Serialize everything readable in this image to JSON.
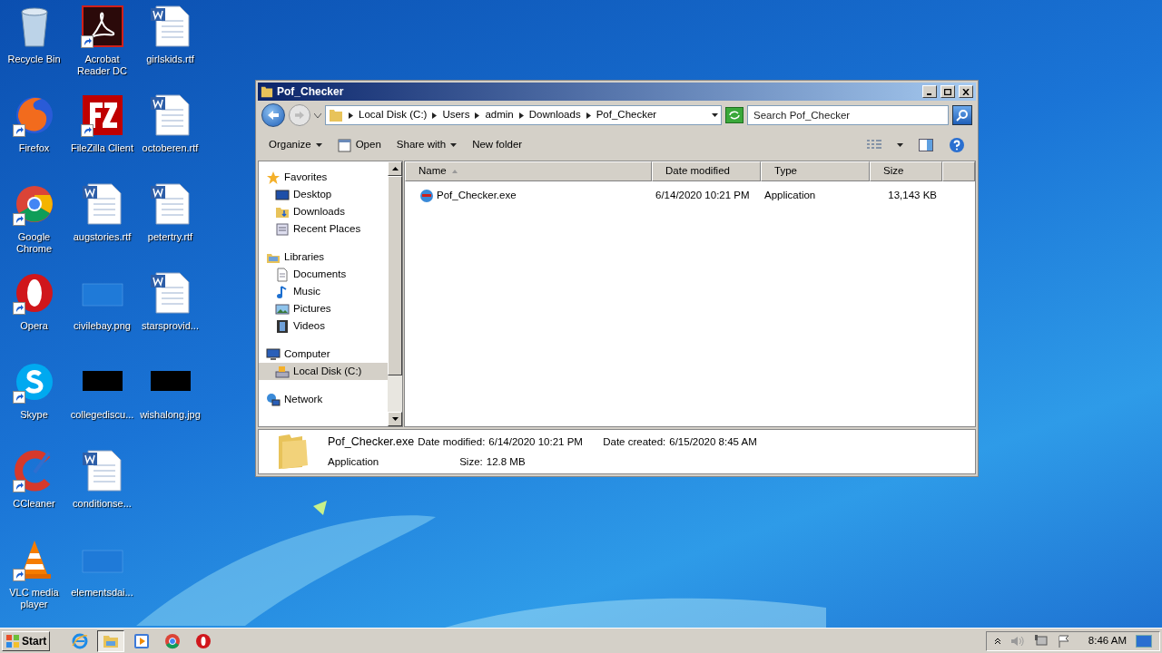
{
  "desktop_icons": [
    {
      "label": "Recycle Bin",
      "kind": "recycle",
      "shortcut": false
    },
    {
      "label": "Firefox",
      "kind": "fox",
      "shortcut": true
    },
    {
      "label": "Google Chrome",
      "kind": "chrome",
      "shortcut": true
    },
    {
      "label": "Opera",
      "kind": "opera",
      "shortcut": true
    },
    {
      "label": "Skype",
      "kind": "skype",
      "shortcut": true
    },
    {
      "label": "CCleaner",
      "kind": "cleaner",
      "shortcut": true
    },
    {
      "label": "VLC media player",
      "kind": "cone",
      "shortcut": true
    },
    {
      "label": "Acrobat Reader DC",
      "kind": "pdf",
      "shortcut": true
    },
    {
      "label": "FileZilla Client",
      "kind": "ftp",
      "shortcut": true
    },
    {
      "label": "augstories.rtf",
      "kind": "doc",
      "shortcut": false
    },
    {
      "label": "civilebay.png",
      "kind": "blank",
      "shortcut": false
    },
    {
      "label": "collegediscu...",
      "kind": "dark",
      "shortcut": false
    },
    {
      "label": "conditionse...",
      "kind": "doc",
      "shortcut": false
    },
    {
      "label": "elementsdai...",
      "kind": "blank",
      "shortcut": false
    },
    {
      "label": "girlskids.rtf",
      "kind": "doc",
      "shortcut": false
    },
    {
      "label": "octoberen.rtf",
      "kind": "doc",
      "shortcut": false
    },
    {
      "label": "petertry.rtf",
      "kind": "doc",
      "shortcut": false
    },
    {
      "label": "starsprovid...",
      "kind": "doc",
      "shortcut": false
    },
    {
      "label": "wishalong.jpg",
      "kind": "dark",
      "shortcut": false
    }
  ],
  "window": {
    "title": "Pof_Checker",
    "breadcrumb": [
      "Local Disk (C:)",
      "Users",
      "admin",
      "Downloads",
      "Pof_Checker"
    ],
    "search": {
      "placeholder": "Search Pof_Checker"
    },
    "toolbar": [
      {
        "label": "Organize",
        "kind": "menu"
      },
      {
        "label": "Open",
        "kind": "open"
      },
      {
        "label": "Share with",
        "kind": "menu"
      },
      {
        "label": "New folder",
        "kind": "plain"
      }
    ],
    "sidebar": [
      {
        "label": "Favorites",
        "kind": "star",
        "selected": false,
        "children": [
          {
            "label": "Desktop",
            "kind": "desktop",
            "selected": false
          },
          {
            "label": "Downloads",
            "kind": "downloads",
            "selected": false
          },
          {
            "label": "Recent Places",
            "kind": "recent",
            "selected": false
          }
        ]
      },
      {
        "label": "Libraries",
        "kind": "library",
        "selected": false,
        "children": [
          {
            "label": "Documents",
            "kind": "document",
            "selected": false
          },
          {
            "label": "Music",
            "kind": "music",
            "selected": false
          },
          {
            "label": "Pictures",
            "kind": "pictures",
            "selected": false
          },
          {
            "label": "Videos",
            "kind": "videos",
            "selected": false
          }
        ]
      },
      {
        "label": "Computer",
        "kind": "computer",
        "selected": false,
        "children": [
          {
            "label": "Local Disk (C:)",
            "kind": "disk",
            "selected": true
          }
        ]
      },
      {
        "label": "Network",
        "kind": "network",
        "selected": false
      }
    ],
    "columns": [
      {
        "label": "Name",
        "sorted": true
      },
      {
        "label": "Date modified",
        "sorted": false
      },
      {
        "label": "Type",
        "sorted": false
      },
      {
        "label": "Size",
        "sorted": false
      }
    ],
    "rows": [
      {
        "name": "Pof_Checker.exe",
        "date_modified": "6/14/2020 10:21 PM",
        "type": "Application",
        "size": "13,143 KB"
      }
    ],
    "details": {
      "name": "Pof_Checker.exe",
      "type": "Application",
      "date_modified_label": "Date modified:",
      "date_modified": "6/14/2020 10:21 PM",
      "date_created_label": "Date created:",
      "date_created": "6/15/2020 8:45 AM",
      "size_label": "Size:",
      "size": "12.8 MB"
    }
  },
  "taskbar": {
    "start": "Start",
    "items": [
      {
        "kind": "ie",
        "selected": false
      },
      {
        "kind": "explorer",
        "selected": true
      },
      {
        "kind": "media",
        "selected": false
      },
      {
        "kind": "chrome",
        "selected": false
      },
      {
        "kind": "opera",
        "selected": false
      }
    ],
    "clock": "8:46 AM"
  }
}
